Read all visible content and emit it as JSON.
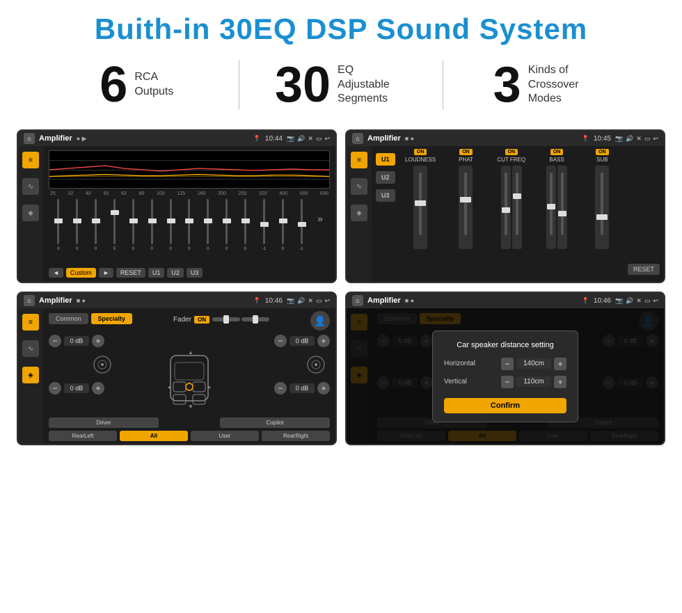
{
  "header": {
    "title": "Buith-in 30EQ DSP Sound System"
  },
  "stats": [
    {
      "number": "6",
      "text_line1": "RCA",
      "text_line2": "Outputs"
    },
    {
      "number": "30",
      "text_line1": "EQ Adjustable",
      "text_line2": "Segments"
    },
    {
      "number": "3",
      "text_line1": "Kinds of",
      "text_line2": "Crossover Modes"
    }
  ],
  "screen1": {
    "app": "Amplifier",
    "time": "10:44",
    "preset": "Custom",
    "buttons": [
      "◄",
      "Custom",
      "►",
      "RESET",
      "U1",
      "U2",
      "U3"
    ],
    "eq_freqs": [
      "25",
      "32",
      "40",
      "50",
      "63",
      "80",
      "100",
      "125",
      "160",
      "200",
      "250",
      "320",
      "400",
      "500",
      "630"
    ],
    "eq_values": [
      "0",
      "0",
      "0",
      "5",
      "0",
      "0",
      "0",
      "0",
      "0",
      "0",
      "0",
      "-1",
      "0",
      "-1"
    ]
  },
  "screen2": {
    "app": "Amplifier",
    "time": "10:45",
    "u_buttons": [
      "U1",
      "U2",
      "U3"
    ],
    "channels": [
      "LOUDNESS",
      "PHAT",
      "CUT FREQ",
      "BASS",
      "SUB"
    ],
    "reset_label": "RESET"
  },
  "screen3": {
    "app": "Amplifier",
    "time": "10:46",
    "tabs": [
      "Common",
      "Specialty"
    ],
    "fader_label": "Fader",
    "fader_on": "ON",
    "db_values": [
      "0 dB",
      "0 dB",
      "0 dB",
      "0 dB"
    ],
    "bottom_buttons": [
      "Driver",
      "",
      "Copilot",
      "RearLeft",
      "All",
      "User",
      "RearRight"
    ]
  },
  "screen4": {
    "app": "Amplifier",
    "time": "10:46",
    "tabs": [
      "Common",
      "Specialty"
    ],
    "dialog": {
      "title": "Car speaker distance setting",
      "horizontal_label": "Horizontal",
      "horizontal_value": "140cm",
      "vertical_label": "Vertical",
      "vertical_value": "110cm",
      "confirm_label": "Confirm"
    },
    "bottom_buttons": [
      "Driver",
      "Copilot",
      "RearLeft",
      "All",
      "User",
      "RearRight"
    ],
    "db_values": [
      "0 dB",
      "0 dB"
    ]
  }
}
